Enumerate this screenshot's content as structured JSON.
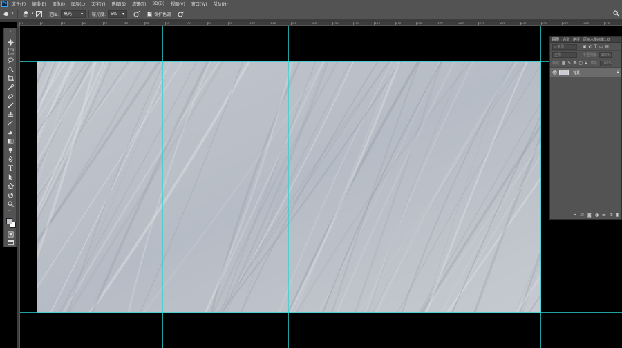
{
  "app": {
    "logo": "Ps"
  },
  "menu": [
    "文件(F)",
    "编辑(E)",
    "图像(I)",
    "图层(L)",
    "文字(Y)",
    "选择(S)",
    "滤镜(T)",
    "3D(D)",
    "视图(V)",
    "窗口(W)",
    "帮助(H)"
  ],
  "options": {
    "range_label": "范围:",
    "range_value": "高光",
    "exposure_label": "曝光度:",
    "exposure_value": "5%",
    "protect_label": "保护色调",
    "brush_size": "65"
  },
  "ruler_labels": [
    "10",
    "0",
    "10",
    "20",
    "30",
    "40",
    "50",
    "60",
    "70",
    "80",
    "90",
    "100",
    "110",
    "120",
    "130",
    "140",
    "150",
    "160",
    "170",
    "180",
    "190",
    "200",
    "210",
    "220",
    "230",
    "240",
    "250",
    "260",
    "270"
  ],
  "layers_panel": {
    "tabs": [
      "图层",
      "通道",
      "路径",
      "原画水墨画笔1.0"
    ],
    "filter_placeholder": "类型",
    "blend_mode": "正常",
    "opacity_label": "不透明度:",
    "opacity_value": "100%",
    "lock_label": "锁定:",
    "fill_label": "填充:",
    "fill_value": "100%",
    "layer_name": "背景",
    "bottom_icons": [
      "link-icon",
      "fx-icon",
      "mask-icon",
      "adjustment-icon",
      "folder-icon",
      "new-layer-icon",
      "trash-icon"
    ]
  },
  "colors": {
    "foreground": "#c4c7cc",
    "background": "#ffffff",
    "guide": "#2ad4d4",
    "ui_bg": "#535353"
  }
}
